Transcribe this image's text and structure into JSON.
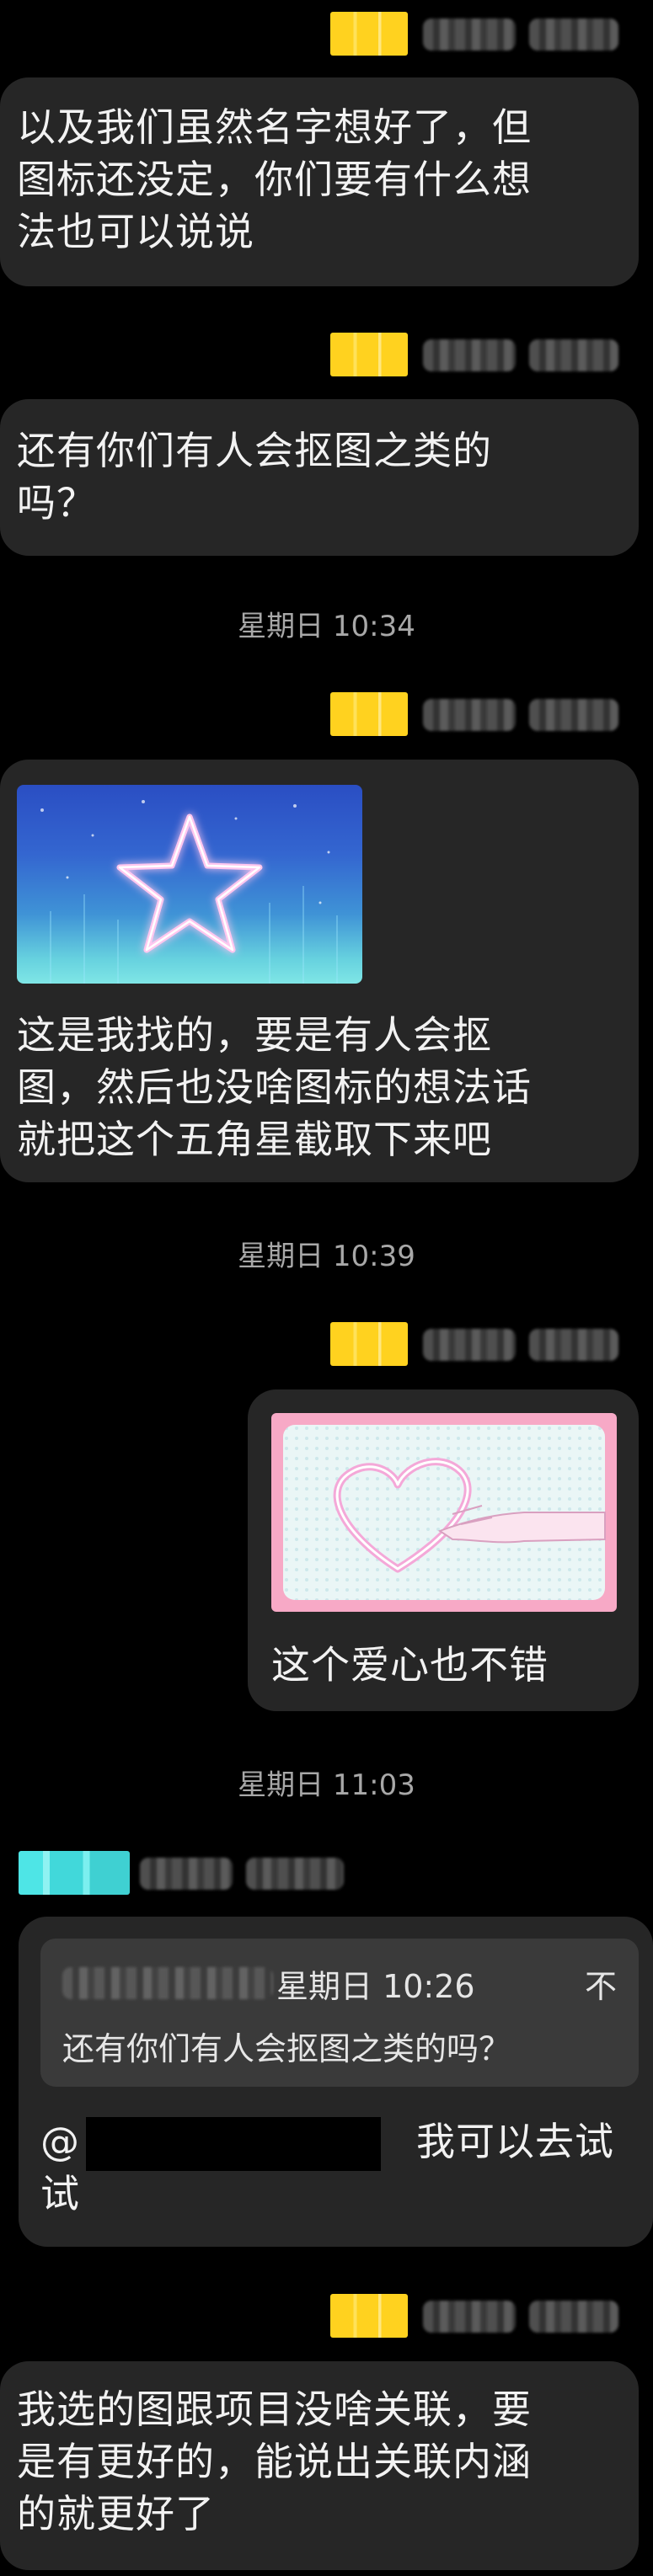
{
  "conversation": {
    "messages": [
      {
        "text": "以及我们虽然名字想好了，但\n图标还没定，你们要有什么想\n法也可以说说"
      },
      {
        "text": "还有你们有人会抠图之类的\n吗？"
      },
      {
        "timestamp": "星期日 10:34"
      },
      {
        "text": "这是我找的，要是有人会抠\n图，然后也没啥图标的想法话\n就把这个五角星截取下来吧"
      },
      {
        "timestamp": "星期日 10:39"
      },
      {
        "text": "这个爱心也不错"
      },
      {
        "timestamp": "星期日 11:03"
      },
      {
        "quote": {
          "time": "星期日 10:26",
          "flag": "不",
          "text": "还有你们有人会抠图之类的吗？"
        },
        "text": "我可以去试\n试",
        "mention": "@"
      },
      {
        "text": "我选的图跟项目没啥关联，要\n是有更好的，能说出关联内涵\n的就更好了"
      }
    ]
  },
  "colors": {
    "background": "#000000",
    "bubble": "#262626",
    "quote_bg": "#3a3a3a",
    "badge_yellow": "#ffd21f",
    "badge_cyan": "#4ee5e6",
    "timestamp_text": "#a8a8a8"
  }
}
